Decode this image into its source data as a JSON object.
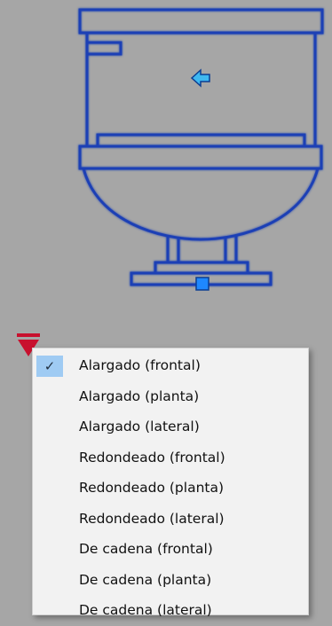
{
  "drawing": {
    "symbol": "toilet-elevation",
    "line_color": "#1f3fb5",
    "grip_color": "#1e88ff",
    "arrow_color": "#3fb8f0",
    "background": "#a6a6a6",
    "handle_color": "#c8102e"
  },
  "menu": {
    "selected_index": 0,
    "items": [
      {
        "label": "Alargado (frontal)",
        "checked": true
      },
      {
        "label": "Alargado (planta)",
        "checked": false
      },
      {
        "label": "Alargado (lateral)",
        "checked": false
      },
      {
        "label": "Redondeado (frontal)",
        "checked": false
      },
      {
        "label": "Redondeado (planta)",
        "checked": false
      },
      {
        "label": "Redondeado (lateral)",
        "checked": false
      },
      {
        "label": "De cadena (frontal)",
        "checked": false
      },
      {
        "label": "De cadena (planta)",
        "checked": false
      },
      {
        "label": "De cadena (lateral)",
        "checked": false
      }
    ]
  }
}
